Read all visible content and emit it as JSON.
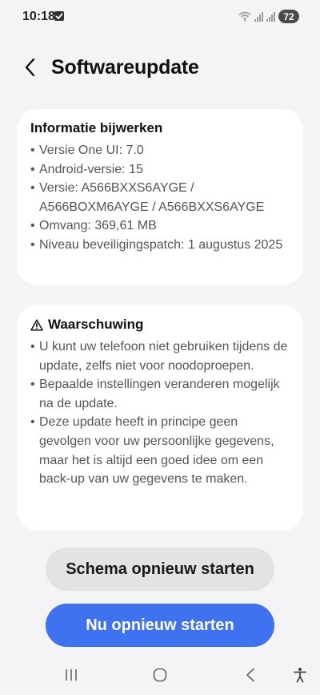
{
  "status_bar": {
    "time": "10:18",
    "battery": "72"
  },
  "header": {
    "title": "Softwareupdate"
  },
  "info_card": {
    "title": "Informatie bijwerken",
    "items": [
      "Versie One UI: 7.0",
      "Android-versie: 15",
      "Versie: A566BXXS6AYGE / A566BOXM6AYGE / A566BXXS6AYGE",
      "Omvang: 369,61 MB",
      "Niveau beveiligingspatch: 1 augustus 2025"
    ]
  },
  "warning_card": {
    "title": "Waarschuwing",
    "items": [
      "U kunt uw telefoon niet gebruiken tijdens de update, zelfs niet voor noodoproepen.",
      "Bepaalde instellingen veranderen mogelijk na de update.",
      "Deze update heeft in principe geen gevolgen voor uw persoonlijke gegevens, maar het is altijd een goed idee om een back-up van uw gegevens te maken."
    ]
  },
  "buttons": {
    "schedule_label": "Schema opnieuw starten",
    "restart_label": "Nu opnieuw starten"
  },
  "colors": {
    "accent": "#3f72f1",
    "background": "#f4f4f6",
    "card": "#ffffff",
    "secondary_button": "#e3e3e6"
  },
  "icons": {
    "back": "chevron-left-icon",
    "warning": "warning-triangle-icon",
    "nav_recents": "recents-icon",
    "nav_home": "home-icon",
    "nav_back": "back-icon",
    "nav_accessibility": "accessibility-icon"
  }
}
